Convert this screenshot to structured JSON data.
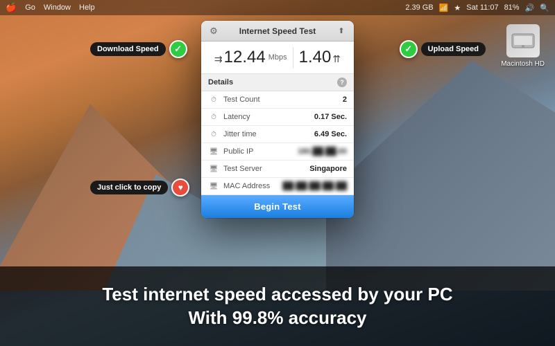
{
  "menubar": {
    "apple": "🍎",
    "items": [
      "Go",
      "Window",
      "Help"
    ],
    "right_items": [
      "⊕",
      "2.39 GB",
      "WiFi",
      "Bluetooth",
      "Sat 11:07",
      "81%",
      "🔊",
      "🔍",
      "☰"
    ]
  },
  "desktop": {
    "icon_label": "Macintosh HD"
  },
  "popup": {
    "title": "Internet Speed Test",
    "download_arrows": "≫",
    "download_speed": "12.44",
    "unit_mbps": "Mbps",
    "upload_speed": "1.40",
    "upload_arrows": "≪",
    "details_label": "Details",
    "help_label": "?",
    "rows": [
      {
        "icon": "⏱",
        "name": "Test Count",
        "value": "2",
        "blurred": false
      },
      {
        "icon": "⏱",
        "name": "Latency",
        "value": "0.17 Sec.",
        "blurred": false
      },
      {
        "icon": "⏱",
        "name": "Jitter time",
        "value": "6.49 Sec.",
        "blurred": false
      },
      {
        "icon": "🖥",
        "name": "Public IP",
        "value": "180.██.██.65",
        "blurred": true
      },
      {
        "icon": "🖥",
        "name": "Test Server",
        "value": "Singapore",
        "blurred": false
      },
      {
        "icon": "🖥",
        "name": "MAC Address",
        "value": "██:██:██:██:██",
        "blurred": true
      }
    ],
    "begin_btn": "Begin Test"
  },
  "badges": {
    "download_label": "Download Speed",
    "upload_label": "Upload Speed",
    "copy_label": "Just click to copy"
  },
  "bottom": {
    "line1": "Test internet speed accessed by your PC",
    "line2": "With 99.8% accuracy"
  }
}
